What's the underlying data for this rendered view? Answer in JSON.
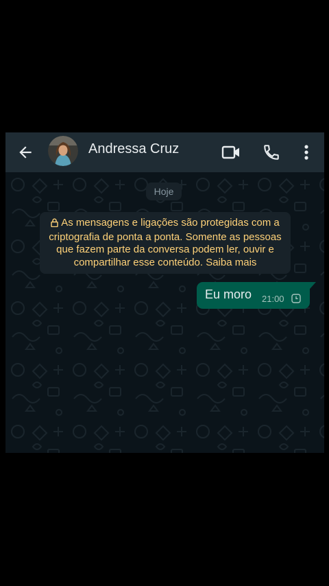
{
  "header": {
    "contact_name": "Andressa Cruz",
    "icons": [
      "back-arrow-icon",
      "video-call-icon",
      "phone-call-icon",
      "more-vert-icon"
    ]
  },
  "chat": {
    "date_label": "Hoje",
    "encryption_notice": "As mensagens e ligações são protegidas com a criptografia de ponta a ponta. Somente as pessoas que fazem parte da conversa podem ler, ouvir e compartilhar esse conteúdo. Saiba mais",
    "messages": [
      {
        "text": "Eu moro",
        "time": "21:00",
        "status": "pending-clock-icon",
        "direction": "outgoing"
      }
    ]
  },
  "colors": {
    "header_bg": "#1f2c34",
    "chat_bg": "#0b141a",
    "outgoing_bubble": "#005c4b",
    "notice_text": "#ffd279"
  }
}
